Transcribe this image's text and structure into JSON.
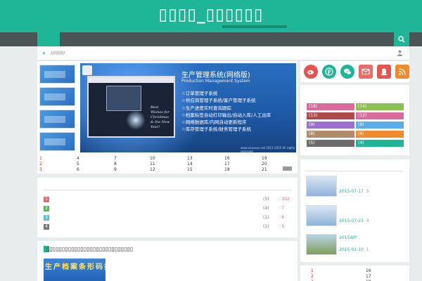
{
  "site": {
    "title": "▯▯▯▯_▯▯▯▯▯▯"
  },
  "notice": {
    "text": "//////////"
  },
  "banner": {
    "title": "生产管理系统(网络版)",
    "subtitle": "Production Management System",
    "features": [
      "☆订单管理子系统",
      "☆供应商管理子系统/客户管理子系统",
      "☆生产进度实时查询跟踪",
      "☆档案标签自动打印输出/自动入库/人工出库",
      "☆网络数据库/内网自动更新程序",
      "☆库存管理子系统/财务管理子系统"
    ],
    "greeting": "Best Wishes for Christmas & the New Year!",
    "footer": "www.xxxxxxx.net 2011-2015 All rights reserved"
  },
  "numbers_grid": [
    [
      "1",
      "4",
      "7",
      "10",
      "13",
      "16",
      "19"
    ],
    [
      "2",
      "5",
      "8",
      "11",
      "14",
      "17",
      "20"
    ],
    [
      "3",
      "6",
      "9",
      "12",
      "15",
      "18",
      "21"
    ]
  ],
  "list": [
    {
      "badge": "1",
      "count": "(5)",
      "likes": "♡102",
      "color": "#e86a6a"
    },
    {
      "badge": "2",
      "count": "(4)",
      "likes": "♡7",
      "color": "#5cb85c"
    },
    {
      "badge": "3",
      "count": "(1)",
      "likes": "♡6",
      "color": "#5bc0de"
    },
    {
      "badge": "4",
      "count": "(1)",
      "likes": "♡5",
      "color": "#777777"
    }
  ],
  "post": {
    "title": "▯▯▯▯▯▯▯▯▯▯▯▯▯▯▯▯▯▯▯▯▯▯▯▯▯▯▯▯",
    "image_text": "生产档案条形码批出仓"
  },
  "social": [
    {
      "name": "weibo",
      "color": "#e8534f"
    },
    {
      "name": "pinterest",
      "color": "#1fb597"
    },
    {
      "name": "wechat",
      "color": "#1fb597"
    },
    {
      "name": "mail",
      "color": "#e86a6a"
    },
    {
      "name": "qq",
      "color": "#e8534f"
    },
    {
      "name": "rss",
      "color": "#f08a2c"
    }
  ],
  "tags": [
    {
      "label": "(18)",
      "color": "#d96a9c"
    },
    {
      "label": "(14)",
      "color": "#8cc152"
    },
    {
      "label": "(13)",
      "color": "#b04a4a"
    },
    {
      "label": "(12)",
      "color": "#d96a9c"
    },
    {
      "label": "(9)",
      "color": "#9b6fcf"
    },
    {
      "label": "(9)",
      "color": "#5aaee8"
    },
    {
      "label": "(8)",
      "color": "#b08a6a"
    },
    {
      "label": "(6)",
      "color": "#f08a2c"
    },
    {
      "label": "(5)",
      "color": "#6b6b6b"
    },
    {
      "label": "(4)",
      "color": "#1fb597"
    }
  ],
  "side_posts": [
    {
      "title": "",
      "date": "2015-07-17",
      "count": "5"
    },
    {
      "title": "",
      "date": "2015-07-23",
      "count": "4"
    },
    {
      "title": "2015WP",
      "date": "2015-01-10",
      "count": "1"
    }
  ],
  "side_numbers": [
    [
      "1",
      "16"
    ],
    [
      "2",
      "17"
    ],
    [
      "3",
      "18"
    ]
  ],
  "colors": {
    "accent": "#1fb597",
    "nav": "#4b5556",
    "page_bg": "#e9ecec"
  }
}
